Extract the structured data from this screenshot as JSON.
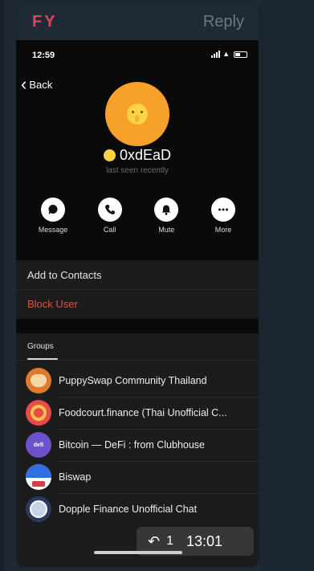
{
  "header": {
    "brand": "FY",
    "reply_label": "Reply"
  },
  "status_bar": {
    "time": "12:59"
  },
  "nav": {
    "back_label": "Back"
  },
  "profile": {
    "name": "0xdEaD",
    "last_seen": "last seen recently",
    "avatar_icon": "shushing-face-icon"
  },
  "actions": [
    {
      "label": "Message",
      "icon": "message-icon"
    },
    {
      "label": "Call",
      "icon": "phone-icon"
    },
    {
      "label": "Mute",
      "icon": "bell-icon"
    },
    {
      "label": "More",
      "icon": "more-icon"
    }
  ],
  "contact_options": {
    "add_label": "Add to Contacts",
    "block_label": "Block User"
  },
  "groups_tab": {
    "label": "Groups"
  },
  "groups": [
    {
      "name": "PuppySwap Community Thailand"
    },
    {
      "name": "Foodcourt.finance (Thai Unofficial C..."
    },
    {
      "name": "Bitcoin — DeFi : from Clubhouse",
      "avatar_text": "defi"
    },
    {
      "name": "Biswap"
    },
    {
      "name": "Dopple Finance Unofficial Chat"
    }
  ],
  "overlay": {
    "reply_count": "1",
    "time": "13:01"
  },
  "colors": {
    "accent_red": "#e0455e",
    "block_red": "#dc5341",
    "avatar_orange": "#f7a12a"
  }
}
